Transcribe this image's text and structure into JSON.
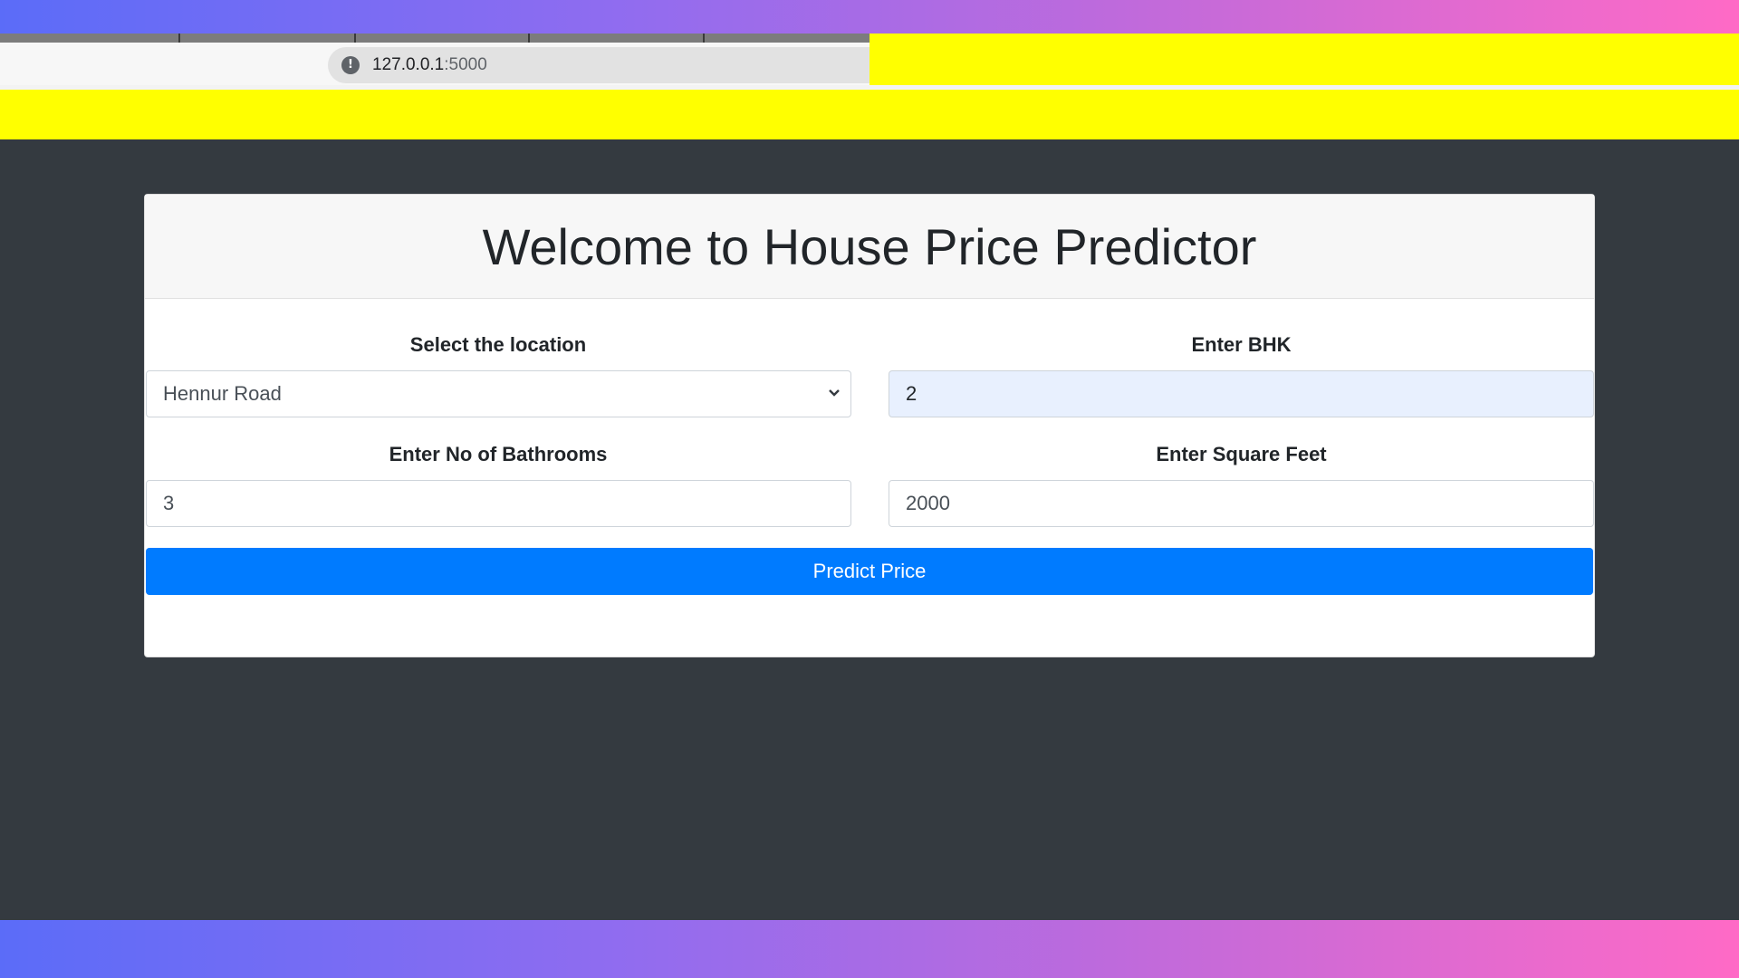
{
  "browser": {
    "url_host": "127.0.0.1",
    "url_port": ":5000"
  },
  "card": {
    "title": "Welcome to House Price Predictor"
  },
  "form": {
    "location_label": "Select the location",
    "location_value": "Hennur Road",
    "bhk_label": "Enter BHK",
    "bhk_value": "2",
    "bathrooms_label": "Enter No of Bathrooms",
    "bathrooms_value": "3",
    "sqft_label": "Enter Square Feet",
    "sqft_value": "2000",
    "predict_label": "Predict Price"
  },
  "colors": {
    "primary_button": "#007bff",
    "page_background": "#343a40",
    "highlight": "#ffff00"
  }
}
